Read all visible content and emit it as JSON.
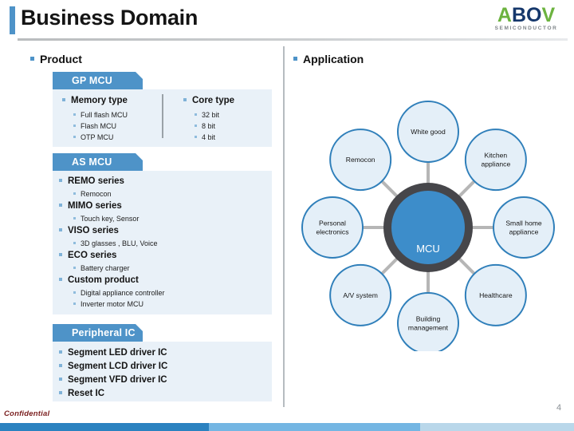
{
  "header": {
    "title": "Business Domain",
    "accent_color": "#4e93c8",
    "logo": {
      "letter_a": "A",
      "letters_bo": "BO",
      "letter_v": "V",
      "tagline": "SEMICONDUCTOR",
      "green": "#6cb33f",
      "navy": "#15376b"
    }
  },
  "sections": {
    "product_heading": "Product",
    "application_heading": "Application"
  },
  "product": {
    "gp_mcu": {
      "tab_label": "GP MCU",
      "groups": [
        {
          "title": "Memory type",
          "items": [
            "Full flash MCU",
            "Flash MCU",
            "OTP MCU"
          ]
        },
        {
          "title": "Core type",
          "items": [
            "32 bit",
            "8 bit",
            "4 bit"
          ]
        }
      ]
    },
    "as_mcu": {
      "tab_label": "AS MCU",
      "groups": [
        {
          "title": "REMO series",
          "items": [
            "Remocon"
          ]
        },
        {
          "title": "MIMO series",
          "items": [
            "Touch key, Sensor"
          ]
        },
        {
          "title": "VISO series",
          "items": [
            "3D glasses , BLU, Voice"
          ]
        },
        {
          "title": "ECO series",
          "items": [
            "Battery charger"
          ]
        },
        {
          "title": "Custom product",
          "items": [
            "Digital appliance controller",
            "Inverter motor MCU"
          ]
        }
      ]
    },
    "peripheral_ic": {
      "tab_label": "Peripheral IC",
      "items": [
        "Segment LED driver IC",
        "Segment LCD driver IC",
        "Segment VFD driver IC",
        "Reset IC"
      ]
    }
  },
  "chart_data": {
    "type": "diagram",
    "subtype": "hub-and-spoke",
    "title": "Application",
    "hub": {
      "label": "MCU",
      "fill": "#3d8dca",
      "ring": "#46464a"
    },
    "node_style": {
      "fill": "#e4eff8",
      "stroke": "#2f7fba",
      "spoke": "#b6b6b6"
    },
    "nodes": [
      {
        "label": "White good",
        "angle_deg": 90,
        "lines": [
          "White good"
        ]
      },
      {
        "label": "Kitchen appliance",
        "angle_deg": 45,
        "lines": [
          "Kitchen",
          "appliance"
        ]
      },
      {
        "label": "Small home appliance",
        "angle_deg": 0,
        "lines": [
          "Small home",
          "appliance"
        ]
      },
      {
        "label": "Healthcare",
        "angle_deg": -45,
        "lines": [
          "Healthcare"
        ]
      },
      {
        "label": "Building management",
        "angle_deg": -90,
        "lines": [
          "Building",
          "management"
        ]
      },
      {
        "label": "A/V system",
        "angle_deg": -135,
        "lines": [
          "A/V system"
        ]
      },
      {
        "label": "Personal electronics",
        "angle_deg": 180,
        "lines": [
          "Personal",
          "electronics"
        ]
      },
      {
        "label": "Remocon",
        "angle_deg": 135,
        "lines": [
          "Remocon"
        ]
      }
    ]
  },
  "footer": {
    "confidential": "Confidential",
    "page_number": "4",
    "bar_colors": [
      "#2b82c0",
      "#74b6e3",
      "#b9d7ea"
    ]
  }
}
